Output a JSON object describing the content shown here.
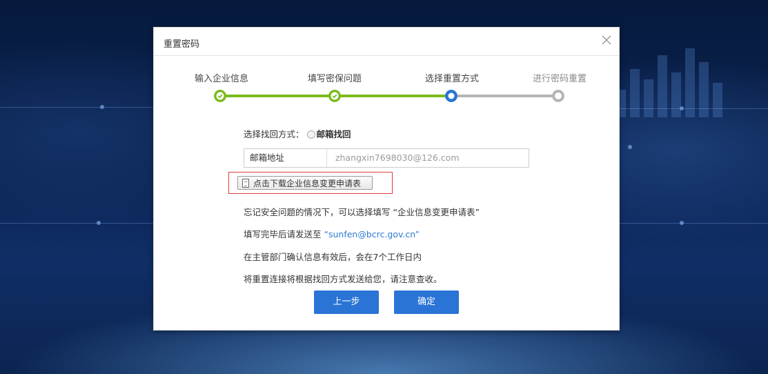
{
  "dialog": {
    "title": "重置密码"
  },
  "steps": [
    {
      "label": "输入企业信息",
      "status": "done"
    },
    {
      "label": "填写密保问题",
      "status": "done"
    },
    {
      "label": "选择重置方式",
      "status": "current"
    },
    {
      "label": "进行密码重置",
      "status": "pending"
    }
  ],
  "colors": {
    "done": "#7bbb1c",
    "current": "#2a74d6",
    "pending": "#b5b5b5",
    "button": "#2a74d6",
    "highlight": "#e23b3b"
  },
  "method": {
    "prefix": "选择找回方式：",
    "option": "邮箱找回"
  },
  "email": {
    "label": "邮箱地址",
    "value": "zhangxin7698030@126.com"
  },
  "download_label": "点击下载企业信息变更申请表",
  "info": {
    "line1": "忘记安全问题的情况下，可以选择填写 “企业信息变更申请表”",
    "line2_prefix": "填写完毕后请发送至",
    "line2_email": "“sunfen@bcrc.gov.cn”",
    "line3": "在主管部门确认信息有效后，会在7个工作日内",
    "line4": "将重置连接将根据找回方式发送给您，请注意查收。"
  },
  "buttons": {
    "prev": "上一步",
    "confirm": "确定"
  }
}
